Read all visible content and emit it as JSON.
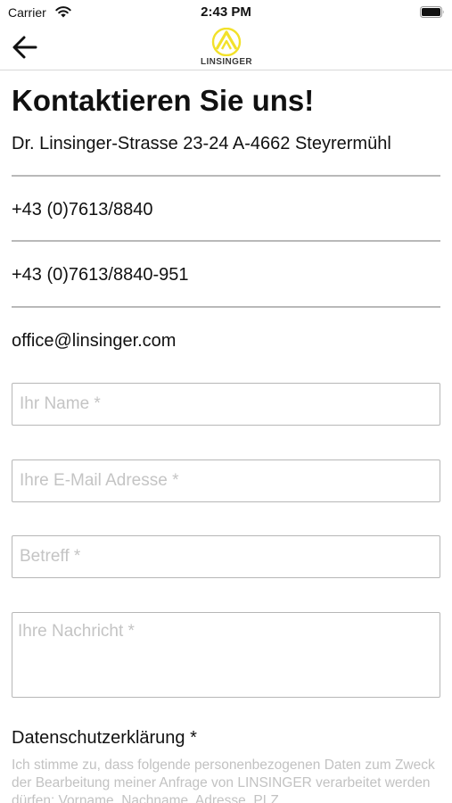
{
  "status_bar": {
    "carrier": "Carrier",
    "time": "2:43 PM"
  },
  "nav": {
    "back_icon": "arrow-left-icon",
    "logo_text": "LINSINGER",
    "logo_color": "#f2e12a"
  },
  "contact": {
    "title": "Kontaktieren Sie uns!",
    "address": "Dr. Linsinger-Strasse 23-24 A-4662 Steyrermühl",
    "phone": "+43 (0)7613/8840",
    "fax": "+43 (0)7613/8840-951",
    "email": "office@linsinger.com"
  },
  "form": {
    "name_placeholder": "Ihr Name *",
    "email_placeholder": "Ihre E-Mail Adresse *",
    "subject_placeholder": "Betreff *",
    "message_placeholder": "Ihre Nachricht *"
  },
  "privacy": {
    "title": "Datenschutzerklärung *",
    "text": "Ich stimme zu, dass folgende personenbezogenen Daten zum Zweck der Bearbeitung meiner Anfrage von LINSINGER verarbeitet werden dürfen: Vorname, Nachname, Adresse, PLZ"
  }
}
